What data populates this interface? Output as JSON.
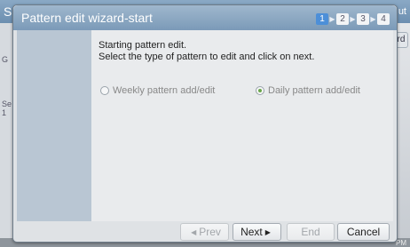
{
  "background": {
    "title_left": "Sc",
    "title_right": "ut",
    "right_button": "rd",
    "left_labels": [
      "G",
      "Se",
      "1"
    ],
    "status_right": "PM"
  },
  "dialog": {
    "title": "Pattern edit wizard-start",
    "steps": [
      {
        "label": "1",
        "active": true
      },
      {
        "label": "2",
        "active": false
      },
      {
        "label": "3",
        "active": false
      },
      {
        "label": "4",
        "active": false
      }
    ],
    "message_line1": "Starting pattern edit.",
    "message_line2": "Select the type of pattern to edit and click on next.",
    "options": [
      {
        "label": "Weekly pattern add/edit",
        "checked": false
      },
      {
        "label": "Daily pattern add/edit",
        "checked": true
      }
    ],
    "buttons": {
      "prev": "Prev",
      "next": "Next",
      "end": "End",
      "cancel": "Cancel"
    }
  }
}
